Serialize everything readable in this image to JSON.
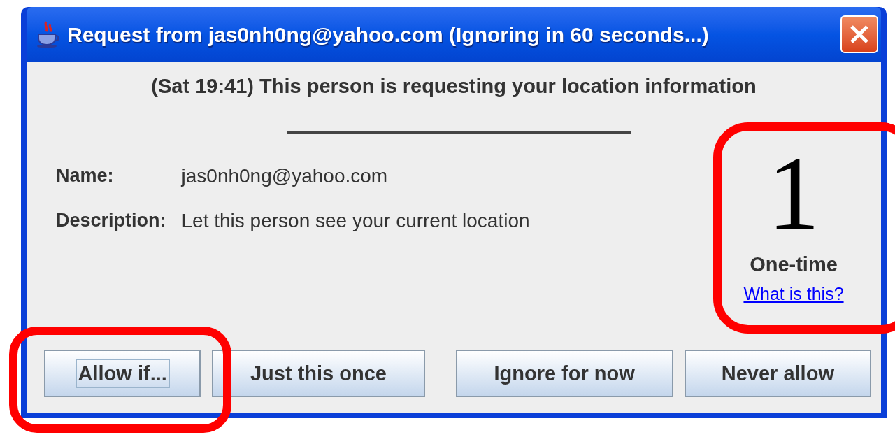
{
  "window": {
    "title": "Request from jas0nh0ng@yahoo.com (Ignoring in 60 seconds...)"
  },
  "heading": "(Sat 19:41) This person is requesting your location information",
  "fields": [
    {
      "label": "Name:",
      "value": "jas0nh0ng@yahoo.com"
    },
    {
      "label": "Description:",
      "value": "Let this person see your current location"
    }
  ],
  "level_panel": {
    "number": "1",
    "caption": "One-time",
    "link": "What is this?"
  },
  "buttons": [
    {
      "label": "Allow if...",
      "focused": true
    },
    {
      "label": "Just this once",
      "focused": false
    },
    {
      "label": "Ignore for now",
      "focused": false
    },
    {
      "label": "Never allow",
      "focused": false
    }
  ]
}
